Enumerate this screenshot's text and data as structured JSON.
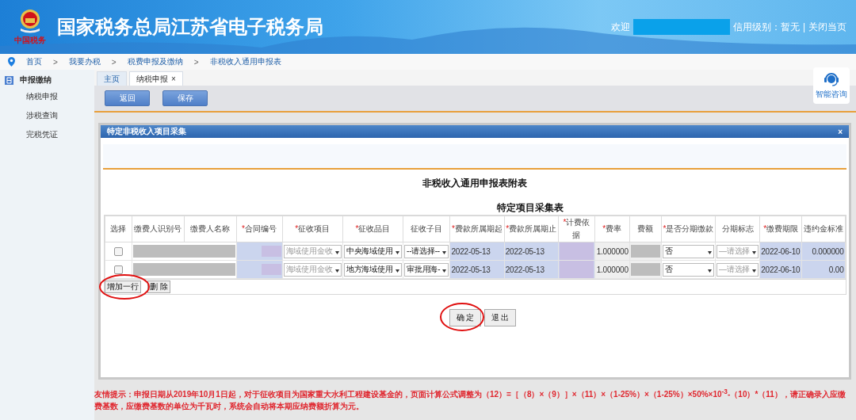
{
  "header": {
    "title": "国家税务总局江苏省电子税务局",
    "emblem_caption": "中国税务",
    "welcome": "欢迎",
    "credit": "信用级别：暂无",
    "separator": "|",
    "close_link": "关闭当页"
  },
  "breadcrumb": [
    "首页",
    "我要办税",
    "税费申报及缴纳",
    "非税收入通用申报表"
  ],
  "breadcrumb_separator": ">",
  "sidebar": {
    "section": "申报缴纳",
    "items": [
      {
        "label": "纳税申报",
        "selected": false
      },
      {
        "label": "涉税查询",
        "selected": false
      },
      {
        "label": "完税凭证",
        "selected": false
      }
    ]
  },
  "tabs": [
    {
      "label": "主页",
      "selected": false,
      "closable": false
    },
    {
      "label": "纳税申报",
      "selected": true,
      "closable": true
    }
  ],
  "tab_close": "×",
  "toolbar": [
    "返回",
    "保存"
  ],
  "assistant": "智能咨询",
  "dialog": {
    "title": "特定非税收入项目采集",
    "close": "×",
    "heading": "非税收入通用申报表附表",
    "subheading": "特定项目采集表",
    "columns": [
      {
        "label": "选择"
      },
      {
        "label": "缴费人识别号"
      },
      {
        "label": "缴费人名称"
      },
      {
        "label": "合同编号",
        "mark": "*"
      },
      {
        "label": "征收项目",
        "mark": "*"
      },
      {
        "label": "征收品目",
        "mark": "*"
      },
      {
        "label": "征收子目"
      },
      {
        "label": "费款所属期起",
        "mark": "*"
      },
      {
        "label": "费款所属期止",
        "mark": "*"
      },
      {
        "label": "计费依据",
        "mark": "*"
      },
      {
        "label": "费率",
        "mark": "*"
      },
      {
        "label": "费额"
      },
      {
        "label": "是否分期缴款",
        "mark": "*"
      },
      {
        "label": "分期标志"
      },
      {
        "label": "缴费期限",
        "mark": "*"
      },
      {
        "label": "违约金标准"
      }
    ],
    "rows": [
      {
        "checked": false,
        "item": "海域使用金收",
        "category": "中央海域使用",
        "subitem": "--请选择--",
        "start": "2022-05-13",
        "end": "2022-05-13",
        "rate": "1.000000",
        "installment": "否",
        "installment_flag": "—请选择",
        "deadline": "2022-06-10",
        "penalty": "0.000000"
      },
      {
        "checked": false,
        "item": "海域使用金收",
        "category": "地方海域使用",
        "subitem": "审批用海-",
        "start": "2022-05-13",
        "end": "2022-05-13",
        "rate": "1.000000",
        "installment": "否",
        "installment_flag": "—请选择",
        "deadline": "2022-06-10",
        "penalty": "0.00"
      }
    ],
    "row_buttons": [
      "增加一行",
      "删 除"
    ],
    "buttons": [
      "确 定",
      "退 出"
    ]
  },
  "notice": "友情提示：申报日期从2019年10月1日起，对于征收项目为国家重大水利工程建设基金的，页面计算公式调整为（12）=［（8）×（9）］×（11）×（1-25%）×（1-25%）×50%×10$^{-3}$-（10）*（11），请正确录入应缴费基数，应缴费基数的单位为千瓦时，系统会自动将本期应纳费额折算为元。"
}
